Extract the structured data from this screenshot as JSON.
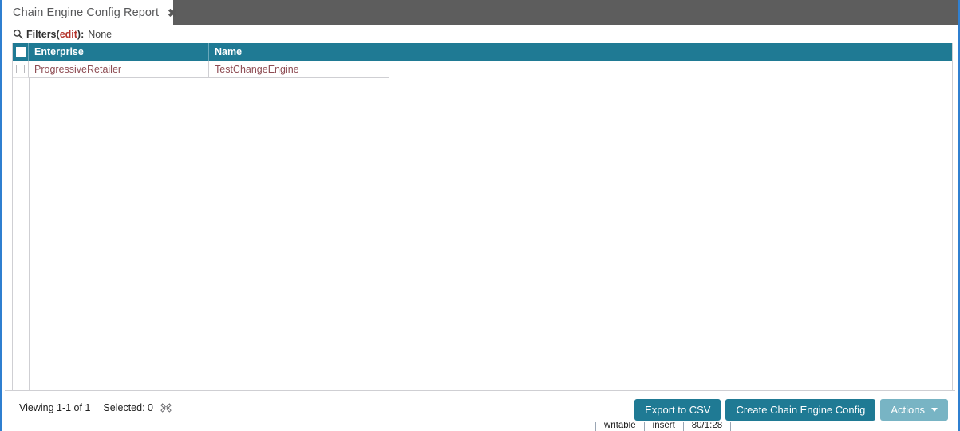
{
  "window": {
    "border_color": "#2f7fd0",
    "tabbar_color": "#5d5d5d"
  },
  "tab": {
    "title": "Chain Engine Config Report",
    "close_glyph": "✖"
  },
  "filters": {
    "icon": "search-icon",
    "label": "Filters",
    "edit_open": "(",
    "edit_label": "edit",
    "edit_close": "):",
    "value": "None"
  },
  "grid": {
    "accent_color": "#1f7a94",
    "select_all_checkbox": "",
    "columns": [
      {
        "key": "enterprise",
        "label": "Enterprise"
      },
      {
        "key": "name",
        "label": "Name"
      }
    ],
    "rows": [
      {
        "checked": false,
        "enterprise": "ProgressiveRetailer",
        "name": "TestChangeEngine"
      }
    ]
  },
  "footer": {
    "viewing": "Viewing 1-1 of 1",
    "selected": "Selected: 0",
    "clear_selection_icon": "clear-selection-icon",
    "buttons": [
      {
        "label": "Export to CSV",
        "style": "primary",
        "caret": false
      },
      {
        "label": "Create Chain Engine Config",
        "style": "primary",
        "caret": false
      },
      {
        "label": "Actions",
        "style": "muted",
        "caret": true
      }
    ]
  },
  "background_window_strip": {
    "cells": [
      "writable",
      "insert",
      "80/1:28"
    ]
  }
}
